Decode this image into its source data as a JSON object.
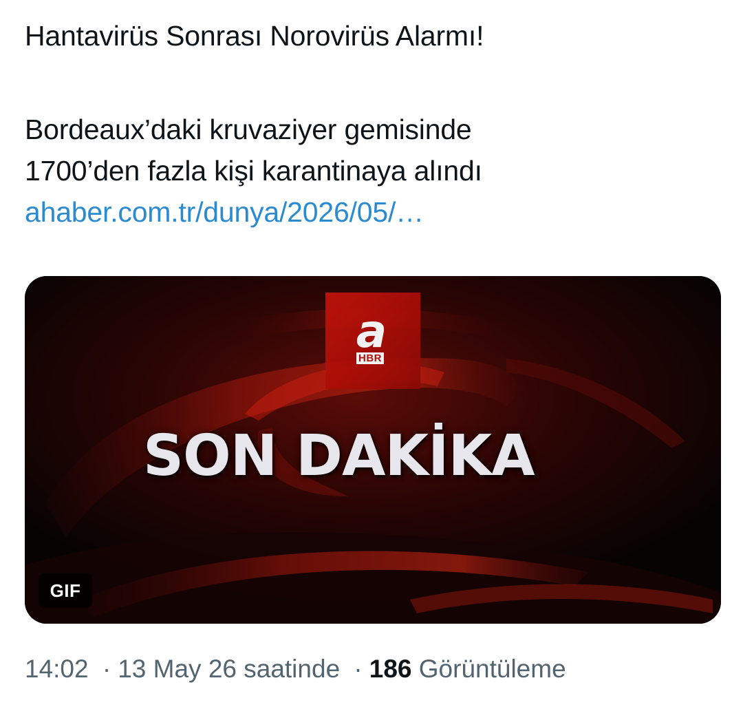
{
  "tweet": {
    "title_line": "Hantavirüs Sonrası Norovirüs Alarmı!",
    "body_line_1": "Bordeaux’daki kruvaziyer gemisinde",
    "body_line_2": "1700’den fazla kişi karantinaya alındı",
    "link_text": "ahaber.com.tr/dunya/2026/05/…"
  },
  "media": {
    "logo_letter": "a",
    "logo_sub": "HBR",
    "headline": "SON DAKİKA",
    "badge": "GIF",
    "accent_red": "#c4140a",
    "background": "#0a0505"
  },
  "meta": {
    "time": "14:02",
    "separator": "·",
    "date_text": "13 May 26 saatinde",
    "view_count": "186",
    "view_label": "Görüntüleme"
  },
  "colors": {
    "text": "#0f1419",
    "link": "#2b8bd0",
    "muted": "#536471"
  }
}
